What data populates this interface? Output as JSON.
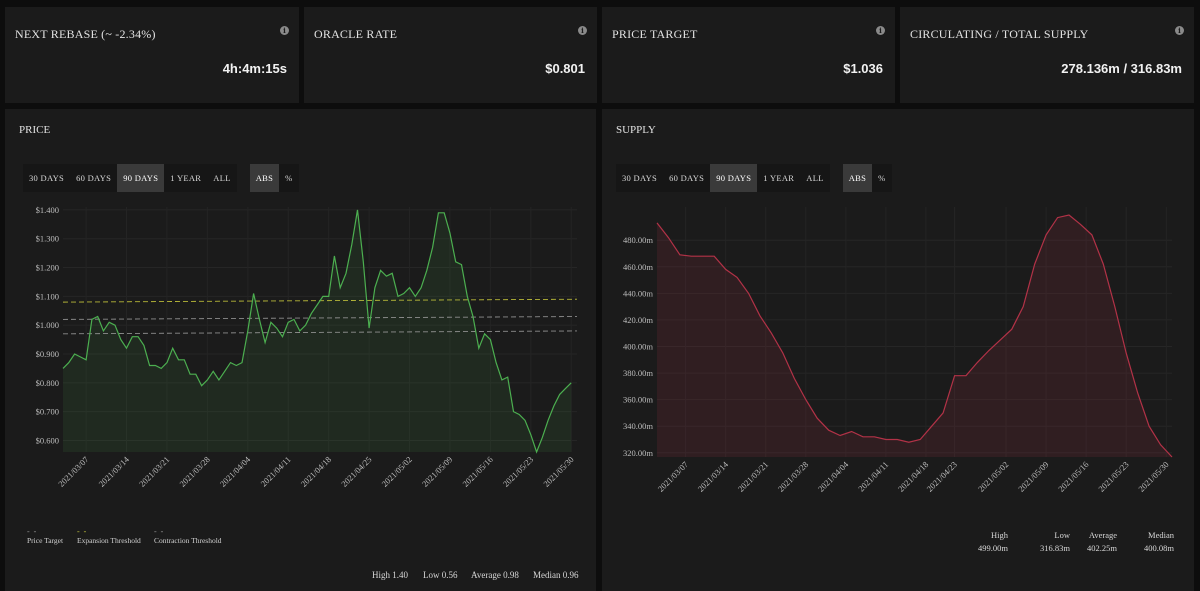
{
  "cards": [
    {
      "title": "NEXT REBASE (~ -2.34%)",
      "value": "4h:4m:15s"
    },
    {
      "title": "ORACLE RATE",
      "value": "$0.801"
    },
    {
      "title": "PRICE TARGET",
      "value": "$1.036"
    },
    {
      "title": "CIRCULATING / TOTAL SUPPLY",
      "value": "278.136m / 316.83m"
    }
  ],
  "price_panel": {
    "title": "PRICE",
    "ranges": [
      "30 DAYS",
      "60 DAYS",
      "90 DAYS",
      "1 YEAR",
      "ALL"
    ],
    "modes": [
      "ABS",
      "%"
    ],
    "active_range": "90 DAYS",
    "active_mode": "ABS",
    "legend": [
      {
        "label": "Price Target",
        "color": "#9a9a9a"
      },
      {
        "label": "Expansion Threshold",
        "color": "#c8c83c"
      },
      {
        "label": "Contraction Threshold",
        "color": "#9a9a9a"
      }
    ],
    "stats": {
      "high": "High 1.40",
      "low": "Low 0.56",
      "average": "Average 0.98",
      "median": "Median 0.96"
    }
  },
  "supply_panel": {
    "title": "SUPPLY",
    "ranges": [
      "30 DAYS",
      "60 DAYS",
      "90 DAYS",
      "1 YEAR",
      "ALL"
    ],
    "modes": [
      "ABS",
      "%"
    ],
    "active_range": "90 DAYS",
    "active_mode": "ABS",
    "stats": [
      {
        "label": "High",
        "value": "499.00m"
      },
      {
        "label": "Low",
        "value": "316.83m"
      },
      {
        "label": "Average",
        "value": "402.25m"
      },
      {
        "label": "Median",
        "value": "400.08m"
      }
    ]
  },
  "chart_data": [
    {
      "type": "line",
      "color": "#4caf50",
      "ylim": [
        0.56,
        1.4
      ],
      "y_ticks": [
        "$0.600",
        "$0.700",
        "$0.800",
        "$0.900",
        "$1.000",
        "$1.100",
        "$1.200",
        "$1.300",
        "$1.400"
      ],
      "y_tick_values": [
        0.6,
        0.7,
        0.8,
        0.9,
        1.0,
        1.1,
        1.2,
        1.3,
        1.4
      ],
      "x_ticks": [
        "2021/03/07",
        "2021/03/14",
        "2021/03/21",
        "2021/03/28",
        "2021/04/04",
        "2021/04/11",
        "2021/04/18",
        "2021/04/25",
        "2021/05/02",
        "2021/05/09",
        "2021/05/16",
        "2021/05/23",
        "2021/05/30"
      ],
      "x_range": [
        "2021/03/03",
        "2021/05/31"
      ],
      "series": [
        {
          "name": "Price",
          "values": [
            [
              "2021/03/03",
              0.85
            ],
            [
              "2021/03/04",
              0.87
            ],
            [
              "2021/03/05",
              0.9
            ],
            [
              "2021/03/06",
              0.89
            ],
            [
              "2021/03/07",
              0.88
            ],
            [
              "2021/03/08",
              1.02
            ],
            [
              "2021/03/09",
              1.03
            ],
            [
              "2021/03/10",
              0.98
            ],
            [
              "2021/03/11",
              1.01
            ],
            [
              "2021/03/12",
              1.0
            ],
            [
              "2021/03/13",
              0.95
            ],
            [
              "2021/03/14",
              0.92
            ],
            [
              "2021/03/15",
              0.96
            ],
            [
              "2021/03/16",
              0.96
            ],
            [
              "2021/03/17",
              0.93
            ],
            [
              "2021/03/18",
              0.86
            ],
            [
              "2021/03/19",
              0.86
            ],
            [
              "2021/03/20",
              0.85
            ],
            [
              "2021/03/21",
              0.87
            ],
            [
              "2021/03/22",
              0.92
            ],
            [
              "2021/03/23",
              0.88
            ],
            [
              "2021/03/24",
              0.88
            ],
            [
              "2021/03/25",
              0.83
            ],
            [
              "2021/03/26",
              0.83
            ],
            [
              "2021/03/27",
              0.79
            ],
            [
              "2021/03/28",
              0.81
            ],
            [
              "2021/03/29",
              0.84
            ],
            [
              "2021/03/30",
              0.81
            ],
            [
              "2021/03/31",
              0.84
            ],
            [
              "2021/04/01",
              0.87
            ],
            [
              "2021/04/02",
              0.86
            ],
            [
              "2021/04/03",
              0.87
            ],
            [
              "2021/04/04",
              0.98
            ],
            [
              "2021/04/05",
              1.11
            ],
            [
              "2021/04/06",
              1.02
            ],
            [
              "2021/04/07",
              0.94
            ],
            [
              "2021/04/08",
              1.01
            ],
            [
              "2021/04/09",
              0.99
            ],
            [
              "2021/04/10",
              0.96
            ],
            [
              "2021/04/11",
              1.01
            ],
            [
              "2021/04/12",
              1.02
            ],
            [
              "2021/04/13",
              0.98
            ],
            [
              "2021/04/14",
              1.0
            ],
            [
              "2021/04/15",
              1.04
            ],
            [
              "2021/04/16",
              1.07
            ],
            [
              "2021/04/17",
              1.1
            ],
            [
              "2021/04/18",
              1.1
            ],
            [
              "2021/04/19",
              1.24
            ],
            [
              "2021/04/20",
              1.13
            ],
            [
              "2021/04/21",
              1.18
            ],
            [
              "2021/04/22",
              1.28
            ],
            [
              "2021/04/23",
              1.4
            ],
            [
              "2021/04/24",
              1.22
            ],
            [
              "2021/04/25",
              0.99
            ],
            [
              "2021/04/26",
              1.13
            ],
            [
              "2021/04/27",
              1.19
            ],
            [
              "2021/04/28",
              1.17
            ],
            [
              "2021/04/29",
              1.18
            ],
            [
              "2021/04/30",
              1.1
            ],
            [
              "2021/05/01",
              1.11
            ],
            [
              "2021/05/02",
              1.13
            ],
            [
              "2021/05/03",
              1.1
            ],
            [
              "2021/05/04",
              1.13
            ],
            [
              "2021/05/05",
              1.19
            ],
            [
              "2021/05/06",
              1.27
            ],
            [
              "2021/05/07",
              1.39
            ],
            [
              "2021/05/08",
              1.39
            ],
            [
              "2021/05/09",
              1.32
            ],
            [
              "2021/05/10",
              1.22
            ],
            [
              "2021/05/11",
              1.21
            ],
            [
              "2021/05/12",
              1.1
            ],
            [
              "2021/05/13",
              1.03
            ],
            [
              "2021/05/14",
              0.92
            ],
            [
              "2021/05/15",
              0.97
            ],
            [
              "2021/05/16",
              0.95
            ],
            [
              "2021/05/17",
              0.87
            ],
            [
              "2021/05/18",
              0.81
            ],
            [
              "2021/05/19",
              0.82
            ],
            [
              "2021/05/20",
              0.7
            ],
            [
              "2021/05/21",
              0.69
            ],
            [
              "2021/05/22",
              0.67
            ],
            [
              "2021/05/23",
              0.62
            ],
            [
              "2021/05/24",
              0.56
            ],
            [
              "2021/05/25",
              0.61
            ],
            [
              "2021/05/26",
              0.67
            ],
            [
              "2021/05/27",
              0.72
            ],
            [
              "2021/05/28",
              0.76
            ],
            [
              "2021/05/29",
              0.78
            ],
            [
              "2021/05/30",
              0.8
            ]
          ]
        },
        {
          "name": "Price Target",
          "color": "#9a9a9a",
          "dashed": true,
          "values": [
            [
              "2021/03/03",
              1.02
            ],
            [
              "2021/05/31",
              1.03
            ]
          ]
        },
        {
          "name": "Expansion Threshold",
          "color": "#c8c83c",
          "dashed": true,
          "values": [
            [
              "2021/03/03",
              1.08
            ],
            [
              "2021/05/31",
              1.09
            ]
          ]
        },
        {
          "name": "Contraction Threshold",
          "color": "#9a9a9a",
          "dashed": true,
          "values": [
            [
              "2021/03/03",
              0.97
            ],
            [
              "2021/05/31",
              0.98
            ]
          ]
        }
      ]
    },
    {
      "type": "line",
      "color": "#b23247",
      "ylim": [
        316.83,
        499.0
      ],
      "y_ticks": [
        "320.00m",
        "340.00m",
        "360.00m",
        "380.00m",
        "400.00m",
        "420.00m",
        "440.00m",
        "460.00m",
        "480.00m"
      ],
      "y_tick_values": [
        320,
        340,
        360,
        380,
        400,
        420,
        440,
        460,
        480
      ],
      "x_ticks": [
        "2021/03/07",
        "2021/03/14",
        "2021/03/21",
        "2021/03/28",
        "2021/04/04",
        "2021/04/11",
        "2021/04/18",
        "2021/04/23",
        "2021/05/02",
        "2021/05/09",
        "2021/05/16",
        "2021/05/23",
        "2021/05/30"
      ],
      "x_range": [
        "2021/03/02",
        "2021/05/31"
      ],
      "series": [
        {
          "name": "Supply",
          "values": [
            [
              "2021/03/02",
              493
            ],
            [
              "2021/03/04",
              482
            ],
            [
              "2021/03/06",
              469
            ],
            [
              "2021/03/08",
              468
            ],
            [
              "2021/03/10",
              468
            ],
            [
              "2021/03/12",
              468
            ],
            [
              "2021/03/14",
              458
            ],
            [
              "2021/03/16",
              452
            ],
            [
              "2021/03/18",
              440
            ],
            [
              "2021/03/20",
              423
            ],
            [
              "2021/03/22",
              410
            ],
            [
              "2021/03/24",
              395
            ],
            [
              "2021/03/26",
              376
            ],
            [
              "2021/03/28",
              360
            ],
            [
              "2021/03/30",
              346
            ],
            [
              "2021/04/01",
              337
            ],
            [
              "2021/04/03",
              333
            ],
            [
              "2021/04/05",
              336
            ],
            [
              "2021/04/07",
              332
            ],
            [
              "2021/04/09",
              332
            ],
            [
              "2021/04/11",
              330
            ],
            [
              "2021/04/13",
              330
            ],
            [
              "2021/04/15",
              328
            ],
            [
              "2021/04/17",
              330
            ],
            [
              "2021/04/19",
              340
            ],
            [
              "2021/04/21",
              350
            ],
            [
              "2021/04/23",
              378
            ],
            [
              "2021/04/25",
              378
            ],
            [
              "2021/04/27",
              388
            ],
            [
              "2021/04/29",
              397
            ],
            [
              "2021/05/01",
              405
            ],
            [
              "2021/05/03",
              413
            ],
            [
              "2021/05/05",
              430
            ],
            [
              "2021/05/07",
              462
            ],
            [
              "2021/05/09",
              484
            ],
            [
              "2021/05/11",
              497
            ],
            [
              "2021/05/13",
              499
            ],
            [
              "2021/05/15",
              492
            ],
            [
              "2021/05/17",
              484
            ],
            [
              "2021/05/19",
              462
            ],
            [
              "2021/05/21",
              430
            ],
            [
              "2021/05/23",
              395
            ],
            [
              "2021/05/25",
              365
            ],
            [
              "2021/05/27",
              340
            ],
            [
              "2021/05/29",
              326
            ],
            [
              "2021/05/31",
              316.83
            ]
          ]
        }
      ]
    }
  ]
}
